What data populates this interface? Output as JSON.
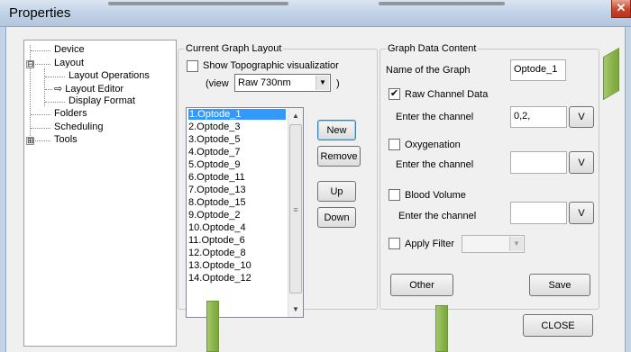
{
  "window": {
    "title": "Properties",
    "close_glyph": "✕"
  },
  "tree": {
    "items": [
      {
        "label": "Device",
        "level": 0
      },
      {
        "label": "Layout",
        "level": 0,
        "expander": "⊟"
      },
      {
        "label": "Layout Operations",
        "level": 1
      },
      {
        "label": "Layout Editor",
        "level": 1,
        "icon": "⇨"
      },
      {
        "label": "Display Format",
        "level": 1
      },
      {
        "label": "Folders",
        "level": 0
      },
      {
        "label": "Scheduling",
        "level": 0
      },
      {
        "label": "Tools",
        "level": 0,
        "expander": "⊞"
      }
    ]
  },
  "layout_group": {
    "title": "Current Graph Layout",
    "topo_label": "Show Topographic visualizatior",
    "view_prefix": "(view",
    "view_value": "Raw 730nm",
    "view_suffix": ")",
    "list": [
      "1.Optode_1",
      "2.Optode_3",
      "3.Optode_5",
      "4.Optode_7",
      "5.Optode_9",
      "6.Optode_11",
      "7.Optode_13",
      "8.Optode_15",
      "9.Optode_2",
      "10.Optode_4",
      "11.Optode_6",
      "12.Optode_8",
      "13.Optode_10",
      "14.Optode_12"
    ],
    "selected_index": 0,
    "buttons": {
      "new": "New",
      "remove": "Remove",
      "up": "Up",
      "down": "Down"
    }
  },
  "data_group": {
    "title": "Graph Data Content",
    "name_label": "Name of the Graph",
    "name_value": "Optode_1",
    "raw_label": "Raw Channel Data",
    "raw_checked": true,
    "raw_channel_label": "Enter the channel",
    "raw_channel_value": "0,2,",
    "oxy_label": "Oxygenation",
    "oxy_checked": false,
    "oxy_channel_label": "Enter the channel",
    "oxy_channel_value": "",
    "bv_label": "Blood Volume",
    "bv_checked": false,
    "bv_channel_label": "Enter the channel",
    "bv_channel_value": "",
    "v_button": "V",
    "filter_label": "Apply Filter",
    "filter_checked": false,
    "other_button": "Other",
    "save_button": "Save"
  },
  "footer": {
    "close_button": "CLOSE"
  },
  "glyphs": {
    "check": "✔",
    "dropdown": "▼",
    "scroll_up": "▲",
    "scroll_down": "▼",
    "grip": "≡"
  },
  "colors": {
    "selection": "#3399ff",
    "annotation_arrow": "#8db54f"
  }
}
